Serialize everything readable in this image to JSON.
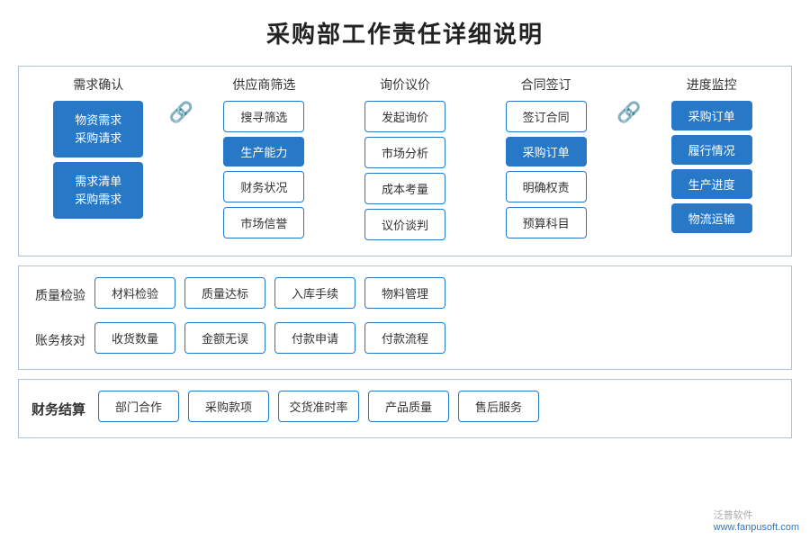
{
  "title": "采购部工作责任详细说明",
  "top_section": {
    "columns": [
      {
        "header": "需求确认",
        "type": "big-blue",
        "buttons": [
          {
            "label": "物资需求\n采购请求",
            "type": "blue-big"
          },
          {
            "label": "需求清单\n采购需求",
            "type": "blue-big"
          }
        ]
      },
      {
        "header": "供应商筛选",
        "buttons": [
          {
            "label": "搜寻筛选",
            "type": "outline"
          },
          {
            "label": "生产能力",
            "type": "blue"
          },
          {
            "label": "财务状况",
            "type": "outline"
          },
          {
            "label": "市场信誉",
            "type": "outline"
          }
        ]
      },
      {
        "header": "询价议价",
        "buttons": [
          {
            "label": "发起询价",
            "type": "outline"
          },
          {
            "label": "市场分析",
            "type": "outline"
          },
          {
            "label": "成本考量",
            "type": "outline"
          },
          {
            "label": "议价谈判",
            "type": "outline"
          }
        ]
      },
      {
        "header": "合同签订",
        "buttons": [
          {
            "label": "签订合同",
            "type": "outline"
          },
          {
            "label": "采购订单",
            "type": "blue"
          },
          {
            "label": "明确权责",
            "type": "outline"
          },
          {
            "label": "预算科目",
            "type": "outline"
          }
        ]
      },
      {
        "header": "进度监控",
        "buttons": [
          {
            "label": "采购订单",
            "type": "blue"
          },
          {
            "label": "履行情况",
            "type": "blue"
          },
          {
            "label": "生产进度",
            "type": "blue"
          },
          {
            "label": "物流运输",
            "type": "blue"
          }
        ]
      }
    ]
  },
  "mid_section": {
    "rows": [
      {
        "label": "质量检验",
        "buttons": [
          "材料检验",
          "质量达标",
          "入库手续",
          "物料管理"
        ]
      },
      {
        "label": "账务核对",
        "buttons": [
          "收货数量",
          "金额无误",
          "付款申请",
          "付款流程"
        ]
      }
    ]
  },
  "bot_section": {
    "label": "财务结算",
    "buttons": [
      "部门合作",
      "采购款项",
      "交货准时率",
      "产品质量",
      "售后服务"
    ]
  },
  "watermark": {
    "site": "www.fanpusoft.com",
    "text": "泛普软件"
  }
}
